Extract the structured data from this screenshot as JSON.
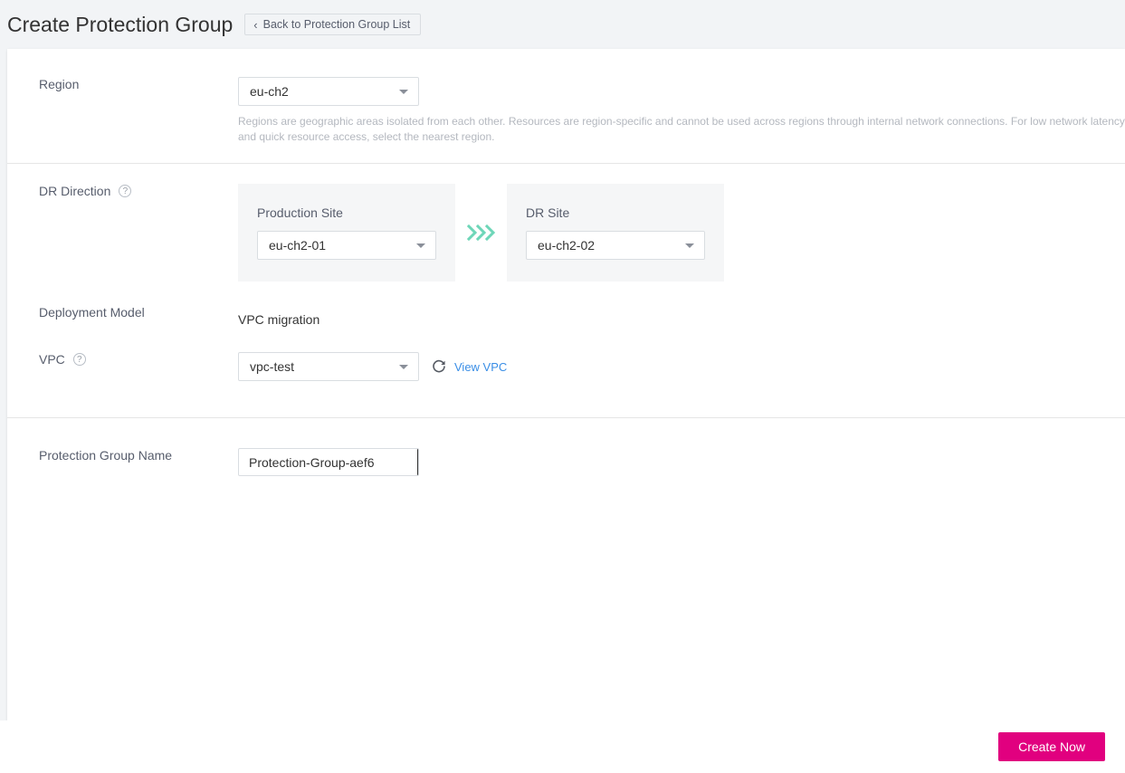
{
  "header": {
    "title": "Create Protection Group",
    "back_button": {
      "label": "Back to Protection Group List",
      "chevron": "‹"
    }
  },
  "form": {
    "region": {
      "label": "Region",
      "value": "eu-ch2",
      "hint": "Regions are geographic areas isolated from each other. Resources are region-specific and cannot be used across regions through internal network connections. For low network latency and quick resource access, select the nearest region."
    },
    "dr_direction": {
      "label": "DR Direction",
      "help": "?",
      "production_site": {
        "title": "Production Site",
        "value": "eu-ch2-01"
      },
      "arrow": "triple-chevron-right",
      "dr_site": {
        "title": "DR Site",
        "value": "eu-ch2-02"
      }
    },
    "deployment_model": {
      "label": "Deployment Model",
      "value": "VPC migration"
    },
    "vpc": {
      "label": "VPC",
      "help": "?",
      "value": "vpc-test",
      "refresh_icon": "refresh-icon",
      "view_link": "View VPC"
    },
    "protection_group_name": {
      "label": "Protection Group Name",
      "value": "Protection-Group-aef6",
      "placeholder": "Protection-Group-aef6"
    }
  },
  "footer": {
    "create_button": "Create Now"
  },
  "colors": {
    "accent": "#e1007f",
    "link": "#3a8ee6",
    "arrow": "#6ed6b8",
    "page_bg": "#f2f4f6",
    "panel_bg": "#f5f6f7",
    "label_text": "#575d6c",
    "hint_text": "#b4b8bf"
  }
}
